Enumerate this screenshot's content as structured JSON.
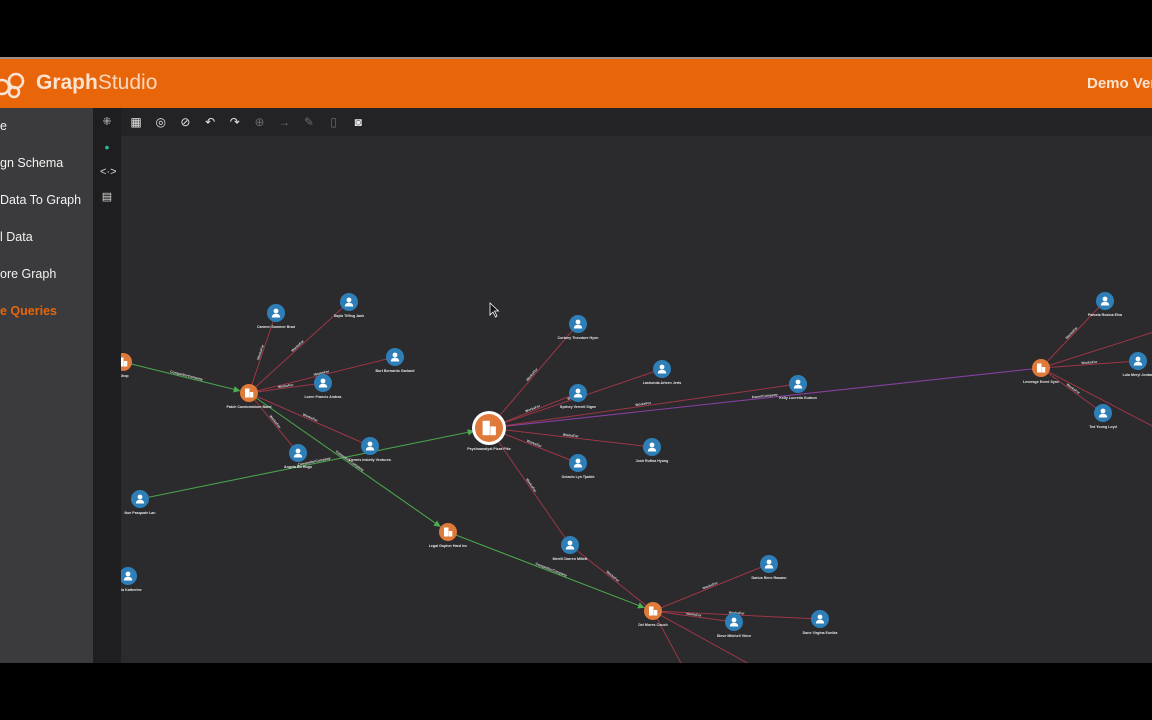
{
  "header": {
    "brand_bold": "Graph",
    "brand_light": "Studio",
    "right_text": "Demo Ver"
  },
  "sidebar": {
    "items": [
      {
        "label": "e",
        "active": false
      },
      {
        "label": "gn Schema",
        "active": false
      },
      {
        "label": " Data To Graph",
        "active": false
      },
      {
        "label": "l Data",
        "active": false
      },
      {
        "label": "ore Graph",
        "active": false
      },
      {
        "label": "e Queries",
        "active": true
      }
    ]
  },
  "icon_column": [
    "collapse-icon",
    "graph-nodes-icon",
    "code-brackets-icon",
    "clipboard-icon"
  ],
  "toolbar": [
    {
      "icon": "grid-icon",
      "enabled": true
    },
    {
      "icon": "locate-icon",
      "enabled": true
    },
    {
      "icon": "hide-icon",
      "enabled": true
    },
    {
      "icon": "undo-icon",
      "enabled": true
    },
    {
      "icon": "redo-icon",
      "enabled": true
    },
    {
      "icon": "add-vertex-icon",
      "enabled": false
    },
    {
      "icon": "add-edge-icon",
      "enabled": false
    },
    {
      "icon": "edit-icon",
      "enabled": false
    },
    {
      "icon": "delete-icon",
      "enabled": false
    },
    {
      "icon": "screenshot-icon",
      "enabled": true
    }
  ],
  "colors": {
    "accent": "#e8650a",
    "company": "#e07a3a",
    "person": "#2e7fb8",
    "works_for": "#a8394a",
    "competitor": "#4caf50",
    "parent": "#8e44ad"
  },
  "edge_types": {
    "works": "WorksFor",
    "comp": "CompetitorCompany",
    "parent": "ParentCompany"
  },
  "graph": {
    "nodes": [
      {
        "id": "c1",
        "type": "company",
        "label": "t Shop"
      },
      {
        "id": "c2",
        "type": "company",
        "label": "Patch Condominium Band"
      },
      {
        "id": "c3",
        "type": "company",
        "label": "Psychoanalyst Pizza Pike",
        "selected": true
      },
      {
        "id": "c4",
        "type": "company",
        "label": "Legal Gopher Hard Inc"
      },
      {
        "id": "c5",
        "type": "company",
        "label": "Del Mores Couch"
      },
      {
        "id": "c6",
        "type": "company",
        "label": "Leverage Event Sync"
      },
      {
        "id": "p1",
        "type": "person",
        "label": "Carmen Sommer Brad"
      },
      {
        "id": "p2",
        "type": "person",
        "label": "Sayla Tiffing Jank"
      },
      {
        "id": "p3",
        "type": "person",
        "label": "Burt Bernardo Garland"
      },
      {
        "id": "p4",
        "type": "person",
        "label": "Loren Francis Andras"
      },
      {
        "id": "p5",
        "type": "person",
        "label": "Dennis Imbelly Venturea"
      },
      {
        "id": "p6",
        "type": "person",
        "label": "Angela Bo Hugo"
      },
      {
        "id": "p7",
        "type": "person",
        "label": "Noe Pasquale Lan"
      },
      {
        "id": "p8",
        "type": "person",
        "label": "Adela Katherine"
      },
      {
        "id": "p9",
        "type": "person",
        "label": "Cortney Theodore Hyon"
      },
      {
        "id": "p10",
        "type": "person",
        "label": "Lashonda Arleen Jerts"
      },
      {
        "id": "p11",
        "type": "person",
        "label": "Sydney Vernell Signe"
      },
      {
        "id": "p12",
        "type": "person",
        "label": "Josh Rufina Hyung"
      },
      {
        "id": "p13",
        "type": "person",
        "label": "Octavio Lyn Tjadde"
      },
      {
        "id": "p14",
        "type": "person",
        "label": "Merrill Darren Millett"
      },
      {
        "id": "p15",
        "type": "person",
        "label": "Kelly Lucretia Gudrun"
      },
      {
        "id": "p16",
        "type": "person",
        "label": "Darius Rene Rasann"
      },
      {
        "id": "p17",
        "type": "person",
        "label": "Steve Mitchell Vince"
      },
      {
        "id": "p18",
        "type": "person",
        "label": "Dane Virgina Eunika"
      },
      {
        "id": "p19",
        "type": "person",
        "label": "Pamela Rosina Elva"
      },
      {
        "id": "p20",
        "type": "person",
        "label": "Lula Meryl Jordan"
      },
      {
        "id": "p21",
        "type": "person",
        "label": "Ted Young Loyd"
      }
    ],
    "edges": [
      [
        "c1",
        "c2",
        "comp"
      ],
      [
        "p7",
        "c3",
        "comp"
      ],
      [
        "c2",
        "c4",
        "comp"
      ],
      [
        "c4",
        "c5",
        "comp"
      ],
      [
        "c3",
        "c6",
        "parent"
      ],
      [
        "p1",
        "c2",
        "works"
      ],
      [
        "p2",
        "c2",
        "works"
      ],
      [
        "p3",
        "c2",
        "works"
      ],
      [
        "p4",
        "c2",
        "works"
      ],
      [
        "p5",
        "c2",
        "works"
      ],
      [
        "p6",
        "c2",
        "works"
      ],
      [
        "p9",
        "c3",
        "works"
      ],
      [
        "p10",
        "c3",
        "works"
      ],
      [
        "p11",
        "c3",
        "works"
      ],
      [
        "p12",
        "c3",
        "works"
      ],
      [
        "p13",
        "c3",
        "works"
      ],
      [
        "p14",
        "c3",
        "works"
      ],
      [
        "p15",
        "c3",
        "works"
      ],
      [
        "p14",
        "c5",
        "works"
      ],
      [
        "p16",
        "c5",
        "works"
      ],
      [
        "p17",
        "c5",
        "works"
      ],
      [
        "p18",
        "c5",
        "works"
      ],
      [
        "c5",
        "x1",
        "works"
      ],
      [
        "c5",
        "x2",
        "works"
      ],
      [
        "p19",
        "c6",
        "works"
      ],
      [
        "p20",
        "c6",
        "works"
      ],
      [
        "p21",
        "c6",
        "works"
      ],
      [
        "c6",
        "x3",
        "works"
      ],
      [
        "c6",
        "x4",
        "works"
      ]
    ]
  }
}
